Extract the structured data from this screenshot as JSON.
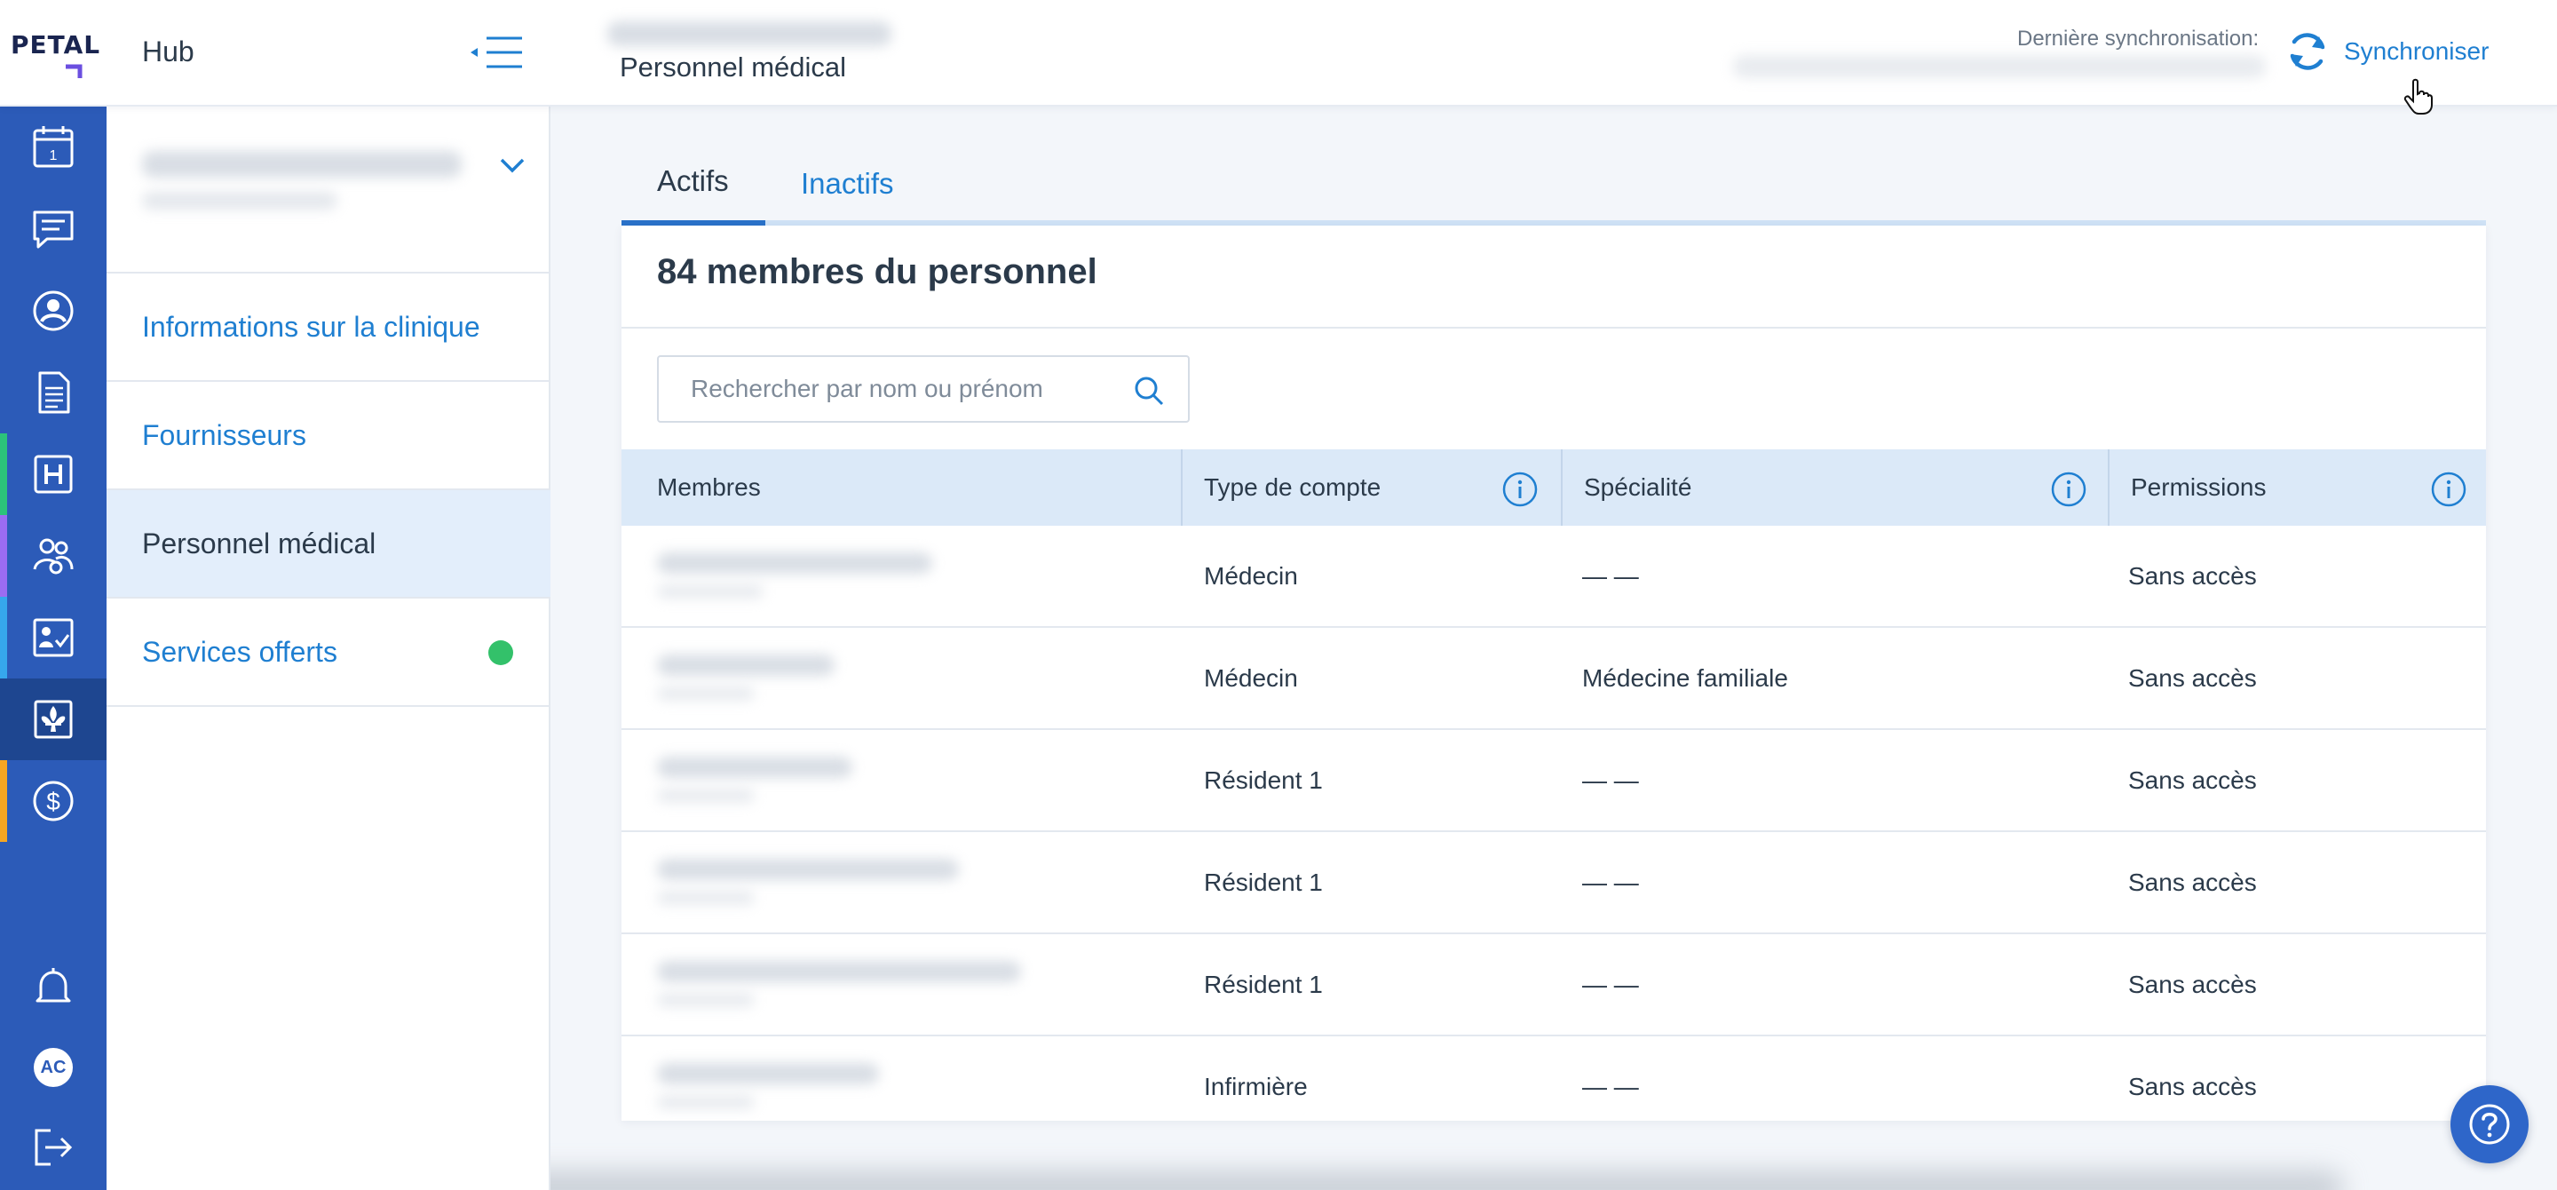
{
  "app": {
    "logo_text": "PETAL",
    "hub_title": "Hub",
    "page_title": "Personnel médical",
    "sync_label": "Dernière synchronisation:",
    "sync_button": "Synchroniser"
  },
  "rail": {
    "icons": [
      "calendar-icon",
      "chat-icon",
      "user-circle-icon",
      "document-icon",
      "hospital-icon",
      "people-icon",
      "checklist-icon",
      "fleur-de-lis-icon",
      "dollar-icon"
    ],
    "calendar_day": "1",
    "avatar_initials": "AC",
    "stripe_colors": {
      "hospital": "#2cc37a",
      "people": "#9b6cf2",
      "checklist": "#36a7ec",
      "dollar": "#f5a623"
    }
  },
  "sidebar": {
    "items": [
      {
        "label": "Informations sur la clinique"
      },
      {
        "label": "Fournisseurs"
      },
      {
        "label": "Personnel médical"
      },
      {
        "label": "Services offerts"
      }
    ]
  },
  "tabs": {
    "active": "Actifs",
    "inactive": "Inactifs"
  },
  "staff": {
    "count_title": "84 membres du personnel",
    "search_placeholder": "Rechercher par nom ou prénom",
    "search_value": "",
    "columns": [
      "Membres",
      "Type de compte",
      "Spécialité",
      "Permissions"
    ],
    "rows": [
      {
        "account_type": "Médecin",
        "specialty": "— —",
        "permissions": "Sans accès"
      },
      {
        "account_type": "Médecin",
        "specialty": "Médecine familiale",
        "permissions": "Sans accès"
      },
      {
        "account_type": "Résident 1",
        "specialty": "— —",
        "permissions": "Sans accès"
      },
      {
        "account_type": "Résident 1",
        "specialty": "— —",
        "permissions": "Sans accès"
      },
      {
        "account_type": "Résident 1",
        "specialty": "— —",
        "permissions": "Sans accès"
      },
      {
        "account_type": "Infirmière",
        "specialty": "— —",
        "permissions": "Sans accès"
      }
    ]
  },
  "colors": {
    "brand_blue": "#2c5bb8",
    "link_blue": "#1f7fd1",
    "status_green": "#33c16a"
  }
}
